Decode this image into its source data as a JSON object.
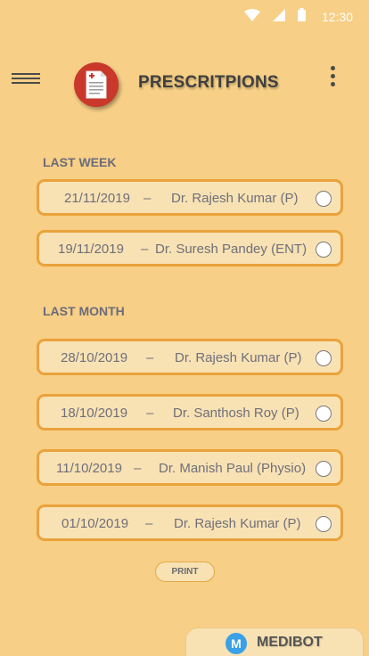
{
  "status_bar": {
    "time": "12:30",
    "icons": [
      "wifi-icon",
      "signal-icon",
      "battery-icon"
    ]
  },
  "header": {
    "title": "PRESCRITPIONS",
    "menu_icon": "hamburger-menu-icon",
    "logo_icon": "prescription-document-icon",
    "more_icon": "kebab-menu-icon"
  },
  "sections": [
    {
      "heading": "LAST WEEK",
      "items": [
        {
          "date": "21/11/2019",
          "separator": "–",
          "doctor": "Dr. Rajesh Kumar (P)"
        },
        {
          "date": "19/11/2019",
          "separator": "–",
          "doctor": "Dr. Suresh Pandey (ENT)"
        }
      ]
    },
    {
      "heading": "LAST MONTH",
      "items": [
        {
          "date": "28/10/2019",
          "separator": "–",
          "doctor": "Dr. Rajesh Kumar (P)"
        },
        {
          "date": "18/10/2019",
          "separator": "–",
          "doctor": "Dr. Santhosh Roy (P)"
        },
        {
          "date": "11/10/2019",
          "separator": "–",
          "doctor": "Dr. Manish Paul (Physio)"
        },
        {
          "date": "01/10/2019",
          "separator": "–",
          "doctor": "Dr. Rajesh Kumar (P)"
        }
      ]
    }
  ],
  "actions": {
    "print_label": "PRINT"
  },
  "brand": {
    "logo_letter": "M",
    "name": "MEDIBOT"
  },
  "colors": {
    "background": "#f7cf86",
    "item_border": "#eaa23b",
    "item_fill": "#f8e2b4",
    "logo_red": "#c9382b",
    "brand_blue": "#3aa0e8"
  }
}
